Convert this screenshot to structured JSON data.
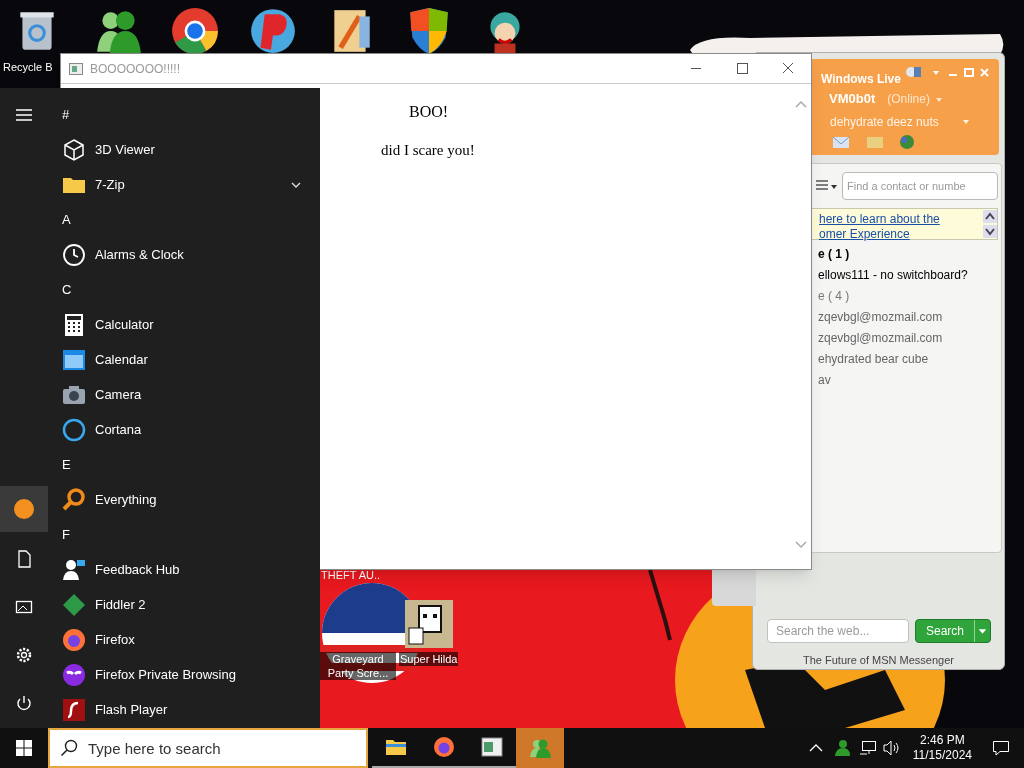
{
  "desktop_icons": [
    {
      "label": "Recycle B"
    },
    {
      "label": "THEFT AU.."
    },
    {
      "label": "Graveyard Party Scre..."
    },
    {
      "label": "Super Hilda"
    }
  ],
  "boo_window": {
    "title": "BOOOOOOO!!!!!",
    "heading": "BOO!",
    "text": "did I scare you!"
  },
  "start_menu": {
    "items": [
      {
        "kind": "header",
        "label": "#"
      },
      {
        "kind": "app",
        "label": "3D Viewer"
      },
      {
        "kind": "folder",
        "label": "7-Zip",
        "expanded": false
      },
      {
        "kind": "header",
        "label": "A"
      },
      {
        "kind": "app",
        "label": "Alarms & Clock"
      },
      {
        "kind": "header",
        "label": "C"
      },
      {
        "kind": "app",
        "label": "Calculator"
      },
      {
        "kind": "app",
        "label": "Calendar"
      },
      {
        "kind": "app",
        "label": "Camera"
      },
      {
        "kind": "app",
        "label": "Cortana"
      },
      {
        "kind": "header",
        "label": "E"
      },
      {
        "kind": "app",
        "label": "Everything"
      },
      {
        "kind": "header",
        "label": "F"
      },
      {
        "kind": "app",
        "label": "Feedback Hub"
      },
      {
        "kind": "app",
        "label": "Fiddler 2"
      },
      {
        "kind": "app",
        "label": "Firefox"
      },
      {
        "kind": "app",
        "label": "Firefox Private Browsing"
      },
      {
        "kind": "app",
        "label": "Flash Player"
      }
    ]
  },
  "messenger": {
    "brand": "Windows Live",
    "username": "VM0b0t",
    "status": "(Online)",
    "personal_message": "dehydrate deez nuts",
    "contact_search": {
      "placeholder": "Find a contact or numbe"
    },
    "banner": [
      " here to learn about the",
      "omer Experience"
    ],
    "contacts": [
      {
        "kind": "group",
        "label": "e ( 1 )"
      },
      {
        "kind": "contact",
        "label": "ellows111 - no switchboard?"
      },
      {
        "kind": "offline_group",
        "label": "e ( 4 )"
      },
      {
        "kind": "offline_contact",
        "label": "zqevbgl@mozmail.com"
      },
      {
        "kind": "offline_contact",
        "label": "zqevbgl@mozmail.com"
      },
      {
        "kind": "offline_contact",
        "label": "ehydrated bear cube"
      },
      {
        "kind": "offline_contact",
        "label": "av"
      }
    ],
    "web_search": {
      "placeholder": "Search the web..."
    },
    "search_button": "Search",
    "footer": "The Future of MSN Messenger"
  },
  "taskbar": {
    "search": {
      "placeholder": "Type here to search"
    },
    "apps": [
      {
        "selected": false
      },
      {
        "selected": false
      },
      {
        "selected": false
      },
      {
        "selected": true
      }
    ],
    "time": "2:46 PM",
    "date": "11/15/2024"
  }
}
